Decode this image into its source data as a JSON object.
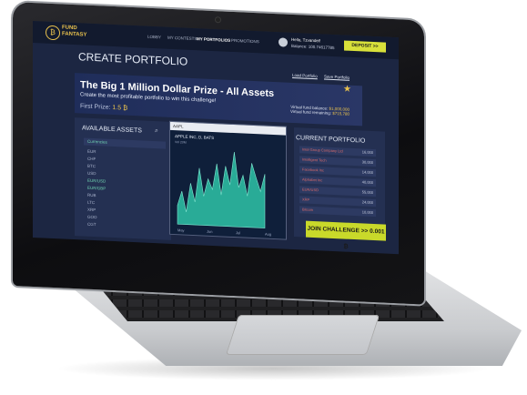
{
  "brand": {
    "line1": "FUND",
    "line2": "FANTASY",
    "logo_glyph": "₿"
  },
  "nav": [
    "LOBBY",
    "MY CONTESTS",
    "MY PORTFOLIOS",
    "PROMOTIONS"
  ],
  "active_nav": "MY PORTFOLIOS",
  "user": {
    "hello": "Hello, Tzvandel!",
    "balance": "Balance: 100.74617785"
  },
  "deposit_label": "DEPOSIT >>",
  "page_title": "CREATE PORTFOLIO",
  "links": {
    "load": "Load Portfolio",
    "save": "Save Portfolio"
  },
  "banner": {
    "title": "The Big 1 Million Dollar Prize - All Assets",
    "subtitle": "Create the most profitable portfolio to win this challenge!",
    "prize_label": "First Prize:",
    "prize_value": "1.5 ₿",
    "vfb_label": "Virtual fund balance:",
    "vfb_value": "$1,000,000",
    "vfr_label": "Virtual fund remaining:",
    "vfr_value": "$715,780"
  },
  "available_assets": {
    "title": "AVAILABLE ASSETS",
    "tab": "Currencies",
    "items": [
      "EUR",
      "CHF",
      "BTC",
      "USD",
      "EUR/USD",
      "EUR/GBP",
      "RUB",
      "LTC",
      "XRP",
      "GOO",
      "CGT"
    ]
  },
  "chart": {
    "symbol": "AAPL",
    "name": "APPLE INC, D, BATS",
    "subtitle": "Vol 23M",
    "months": [
      "May",
      "Jun",
      "Jul",
      "Aug"
    ]
  },
  "current_portfolio": {
    "title": "CURRENT PORTFOLIO",
    "rows": [
      {
        "name": "Intel Group Company Ltd",
        "value": "16,000"
      },
      {
        "name": "Intelligent Tech",
        "value": "30,000"
      },
      {
        "name": "Facebook Inc",
        "value": "14,000"
      },
      {
        "name": "Alphabet Inc",
        "value": "40,000"
      },
      {
        "name": "EUR/USD",
        "value": "55,000"
      },
      {
        "name": "XRP",
        "value": "24,000"
      },
      {
        "name": "Bitcoin",
        "value": "10,000"
      }
    ]
  },
  "join_label": "JOIN CHALLENGE >>",
  "join_value": "0.001 ₿",
  "chart_data": {
    "type": "area",
    "x": [
      "May",
      "Jun",
      "Jul",
      "Aug"
    ],
    "series": [
      {
        "values": [
          18,
          32,
          12,
          40,
          22,
          55,
          28,
          45,
          35,
          60,
          30,
          58,
          40,
          72,
          38,
          50,
          30,
          62,
          48,
          35,
          52
        ]
      }
    ]
  },
  "colors": {
    "accent": "#d8e03a",
    "gold": "#e8c14d",
    "teal": "#2ec4a8",
    "bg": "#1c2642"
  }
}
